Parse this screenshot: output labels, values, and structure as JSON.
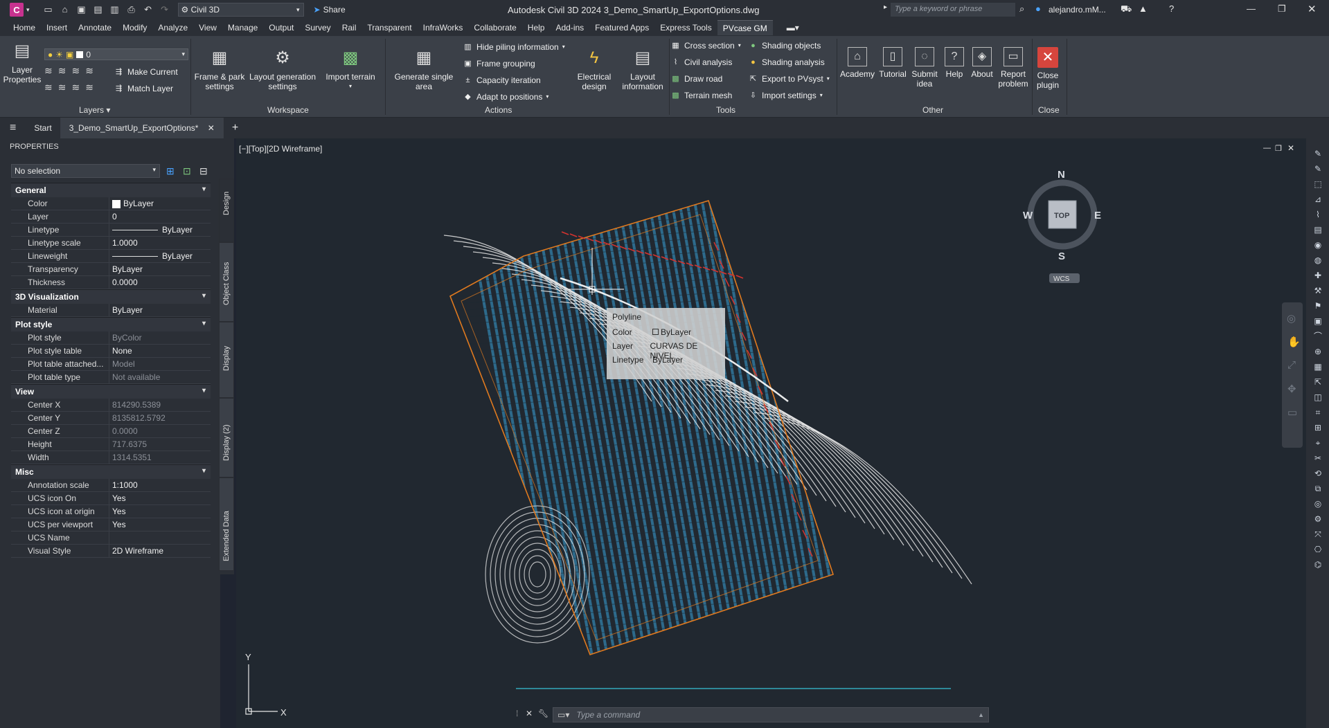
{
  "titlebar": {
    "app_letter": "C",
    "workspace": "Civil 3D",
    "share_label": "Share",
    "title": "Autodesk Civil 3D 2024   3_Demo_SmartUp_ExportOptions.dwg",
    "search_placeholder": "Type a keyword or phrase",
    "user": "alejandro.mM..."
  },
  "ribbon_tabs": [
    "Home",
    "Insert",
    "Annotate",
    "Modify",
    "Analyze",
    "View",
    "Manage",
    "Output",
    "Survey",
    "Rail",
    "Transparent",
    "InfraWorks",
    "Collaborate",
    "Help",
    "Add-ins",
    "Featured Apps",
    "Express Tools",
    "PVcase GM"
  ],
  "ribbon": {
    "layers": {
      "layer_properties": "Layer Properties",
      "layer_value": "0",
      "make_current": "Make Current",
      "match_layer": "Match Layer",
      "title": "Layers"
    },
    "workspace": {
      "frame_park": "Frame & park settings",
      "layout_gen": "Layout generation settings",
      "import_terrain": "Import terrain",
      "title": "Workspace"
    },
    "actions": {
      "generate_single": "Generate single area",
      "hide_piling": "Hide piling information",
      "frame_grouping": "Frame grouping",
      "capacity_iteration": "Capacity iteration",
      "adapt_positions": "Adapt to positions",
      "electrical_design": "Electrical design",
      "layout_information": "Layout information",
      "title": "Actions"
    },
    "tools": {
      "cross_section": "Cross section",
      "civil_analysis": "Civil analysis",
      "draw_road": "Draw road",
      "terrain_mesh": "Terrain mesh",
      "shading_objects": "Shading objects",
      "shading_analysis": "Shading analysis",
      "export_pvsyst": "Export to PVsyst",
      "import_settings": "Import settings",
      "title": "Tools"
    },
    "other": {
      "academy": "Academy",
      "tutorial": "Tutorial",
      "submit_idea": "Submit idea",
      "help": "Help",
      "about": "About",
      "report_problem": "Report problem",
      "title": "Other"
    },
    "close": {
      "close_plugin": "Close plugin",
      "title": "Close"
    }
  },
  "doc_tabs": {
    "start": "Start",
    "active": "3_Demo_SmartUp_ExportOptions*"
  },
  "properties": {
    "header": "PROPERTIES",
    "selection": "No selection",
    "categories": [
      {
        "name": "General",
        "rows": [
          {
            "k": "Color",
            "v": "ByLayer"
          },
          {
            "k": "Layer",
            "v": "0"
          },
          {
            "k": "Linetype",
            "v": "ByLayer"
          },
          {
            "k": "Linetype scale",
            "v": "1.0000"
          },
          {
            "k": "Lineweight",
            "v": "ByLayer"
          },
          {
            "k": "Transparency",
            "v": "ByLayer"
          },
          {
            "k": "Thickness",
            "v": "0.0000"
          }
        ]
      },
      {
        "name": "3D Visualization",
        "rows": [
          {
            "k": "Material",
            "v": "ByLayer"
          }
        ]
      },
      {
        "name": "Plot style",
        "rows": [
          {
            "k": "Plot style",
            "v": "ByColor",
            "dim": true
          },
          {
            "k": "Plot style table",
            "v": "None"
          },
          {
            "k": "Plot table attached...",
            "v": "Model",
            "dim": true
          },
          {
            "k": "Plot table type",
            "v": "Not available",
            "dim": true
          }
        ]
      },
      {
        "name": "View",
        "rows": [
          {
            "k": "Center X",
            "v": "814290.5389",
            "dim": true
          },
          {
            "k": "Center Y",
            "v": "8135812.5792",
            "dim": true
          },
          {
            "k": "Center Z",
            "v": "0.0000",
            "dim": true
          },
          {
            "k": "Height",
            "v": "717.6375",
            "dim": true
          },
          {
            "k": "Width",
            "v": "1314.5351",
            "dim": true
          }
        ]
      },
      {
        "name": "Misc",
        "rows": [
          {
            "k": "Annotation scale",
            "v": "1:1000"
          },
          {
            "k": "UCS icon On",
            "v": "Yes"
          },
          {
            "k": "UCS icon at origin",
            "v": "Yes"
          },
          {
            "k": "UCS per viewport",
            "v": "Yes"
          },
          {
            "k": "UCS Name",
            "v": ""
          },
          {
            "k": "Visual Style",
            "v": "2D Wireframe"
          }
        ]
      }
    ],
    "side_tabs": [
      "Design",
      "Object Class",
      "Display",
      "Display (2)",
      "Extended Data"
    ]
  },
  "viewport": {
    "label": "[−][Top][2D Wireframe]",
    "tooltip": {
      "title": "Polyline",
      "rows": [
        {
          "k": "Color",
          "v": "ByLayer"
        },
        {
          "k": "Layer",
          "v": "CURVAS DE NIVEL"
        },
        {
          "k": "Linetype",
          "v": "ByLayer"
        }
      ]
    },
    "viewcube": {
      "n": "N",
      "s": "S",
      "e": "E",
      "w": "W",
      "face": "TOP",
      "wcs": "WCS"
    },
    "ucs": {
      "x": "X",
      "y": "Y"
    },
    "command_placeholder": "Type a command"
  },
  "colors": {
    "accent_pvcase": "#d6453d",
    "grid_blue": "#3aa0d8",
    "boundary_orange": "#e07a1f",
    "contour_white": "#e8e8e8"
  }
}
